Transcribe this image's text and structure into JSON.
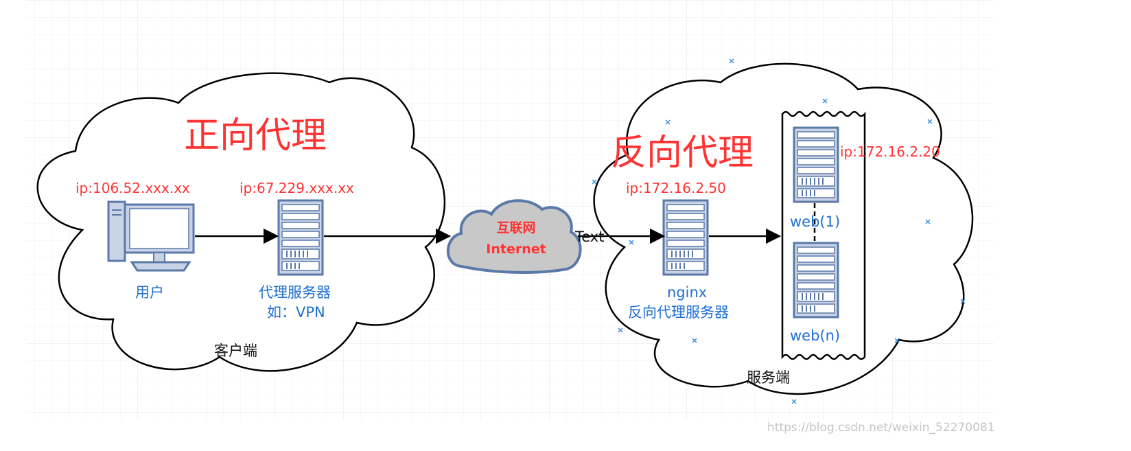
{
  "diagram": {
    "client": {
      "title": "正向代理",
      "user_ip": "ip:106.52.xxx.xx",
      "proxy_ip": "ip:67.229.xxx.xx",
      "user_label": "用户",
      "proxy_label_1": "代理服务器",
      "proxy_label_2": "如：VPN",
      "cloud_label": "客户端"
    },
    "internet": {
      "label_cn": "互联网",
      "label_en": "Internet",
      "edge_label": "Text"
    },
    "server": {
      "title": "反向代理",
      "nginx_ip": "ip:172.16.2.50",
      "web_ip": "ip:172.16.2.20",
      "nginx_label_1": "nginx",
      "nginx_label_2": "反向代理服务器",
      "web1_label": "web(1)",
      "webn_label": "web(n)",
      "cloud_label": "服务端"
    },
    "watermark": "https://blog.csdn.net/weixin_52270081"
  },
  "colors": {
    "title_red": "#ff3333",
    "label_blue": "#1e6fd0",
    "server_fill": "#c9d3e6",
    "server_stroke": "#5a79a8",
    "internet_fill": "#c8c8c8",
    "internet_stroke": "#5a79a8",
    "grid": "#ececec"
  }
}
